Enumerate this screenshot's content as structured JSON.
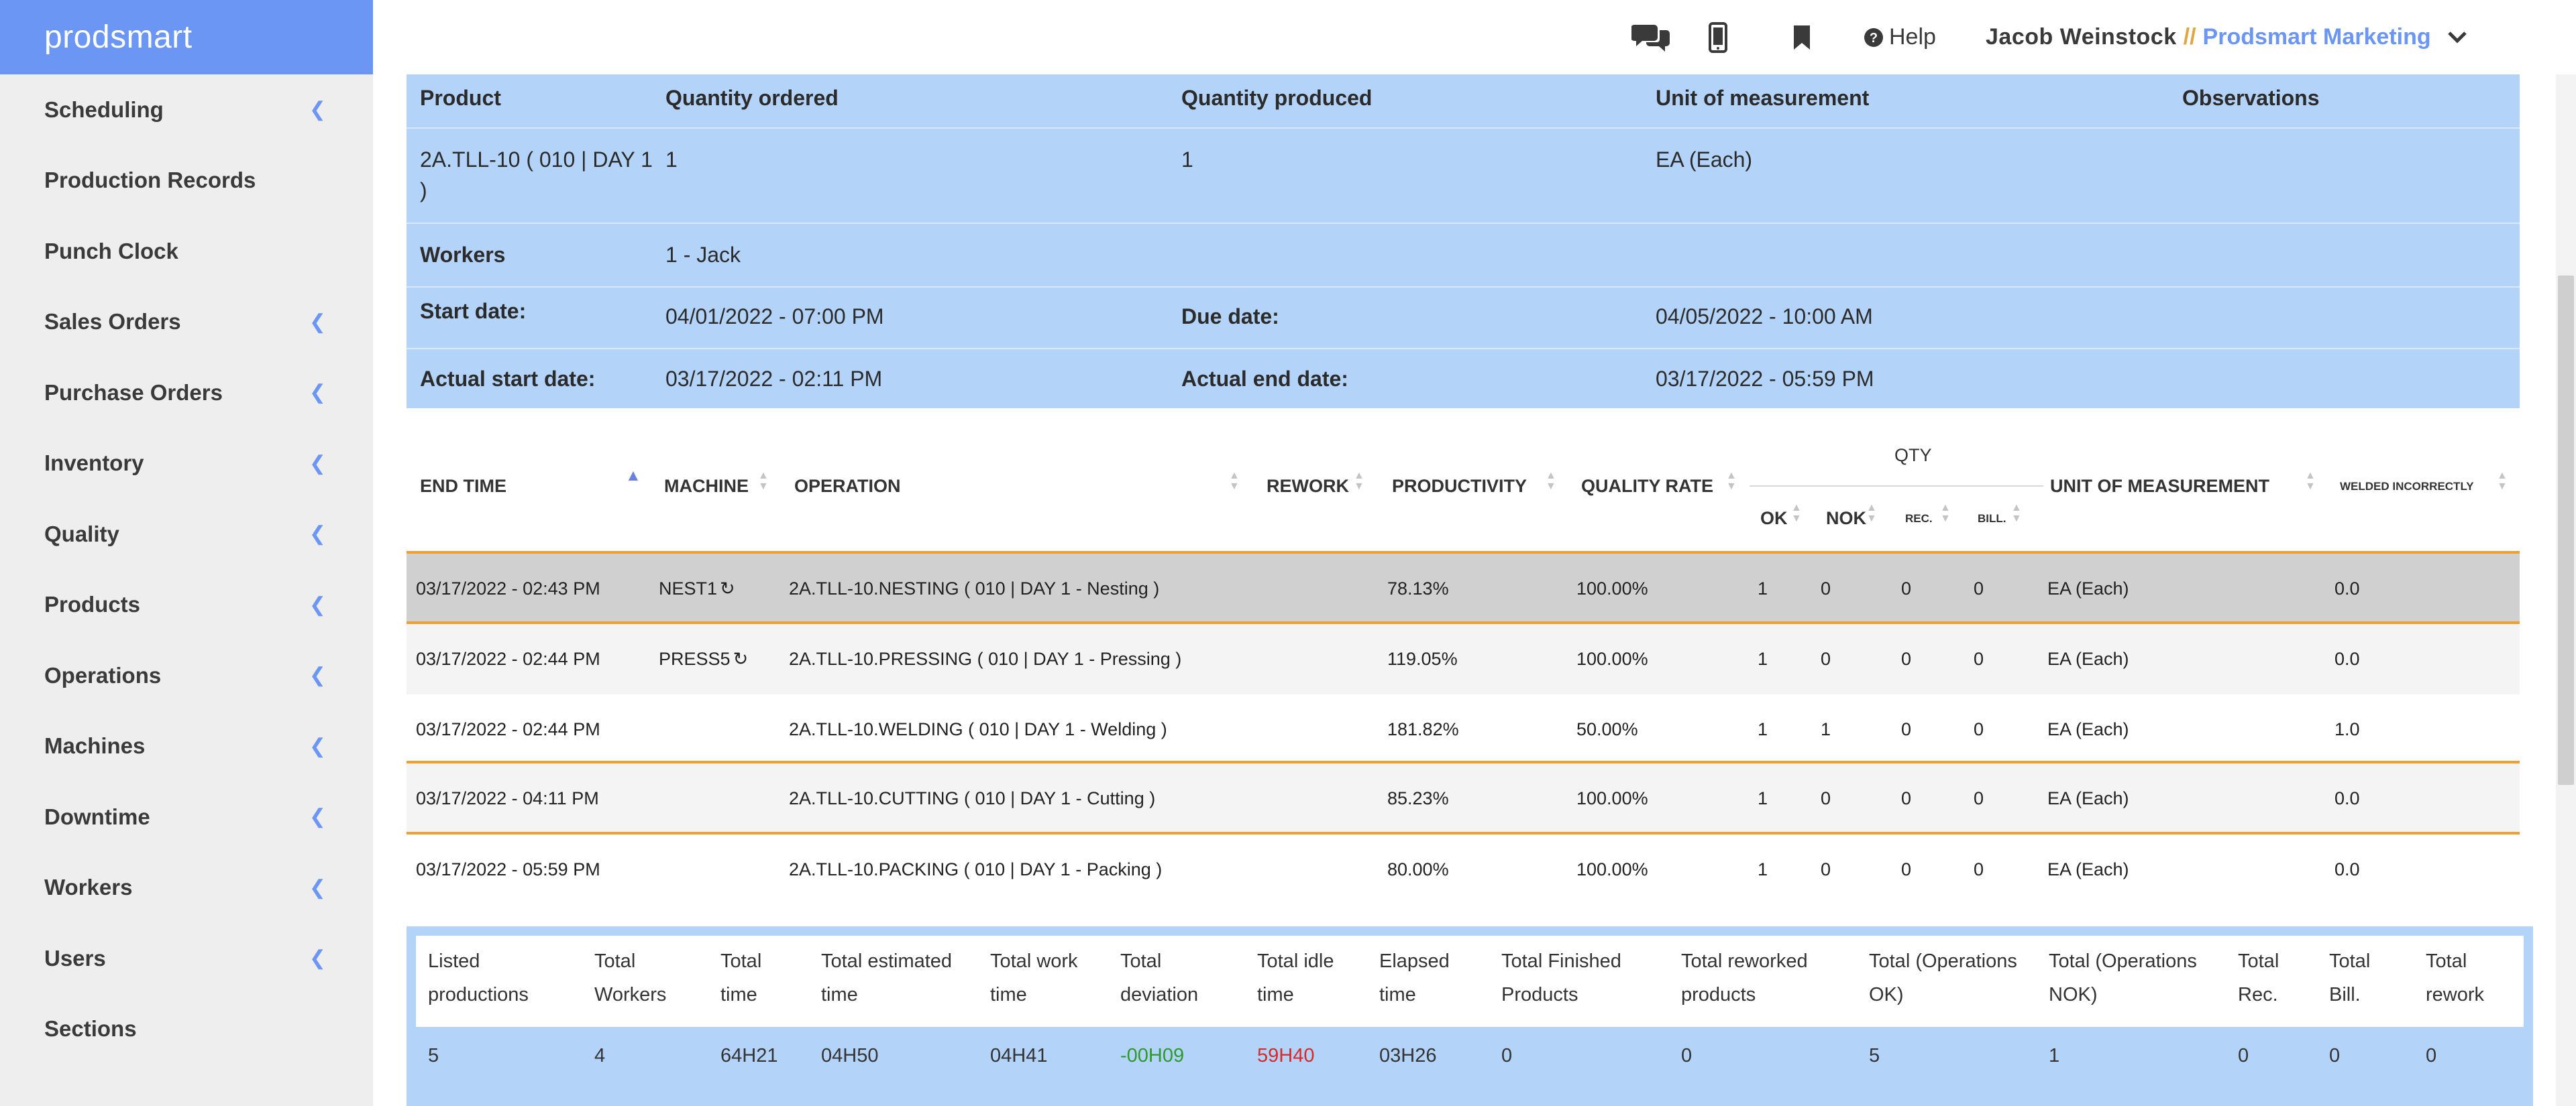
{
  "sidebar": {
    "brand": "prodsmart",
    "items": [
      {
        "label": "Scheduling",
        "chevron": true
      },
      {
        "label": "Production Records",
        "chevron": false
      },
      {
        "label": "Punch Clock",
        "chevron": false
      },
      {
        "label": "Sales Orders",
        "chevron": true
      },
      {
        "label": "Purchase Orders",
        "chevron": true
      },
      {
        "label": "Inventory",
        "chevron": true
      },
      {
        "label": "Quality",
        "chevron": true
      },
      {
        "label": "Products",
        "chevron": true
      },
      {
        "label": "Operations",
        "chevron": true
      },
      {
        "label": "Machines",
        "chevron": true
      },
      {
        "label": "Downtime",
        "chevron": true
      },
      {
        "label": "Workers",
        "chevron": true
      },
      {
        "label": "Users",
        "chevron": true
      },
      {
        "label": "Sections",
        "chevron": false
      }
    ]
  },
  "topbar": {
    "help": "Help",
    "user_name": "Jacob Weinstock",
    "separator": "//",
    "company": "Prodsmart Marketing",
    "icons": [
      "chat-icon",
      "mobile-icon",
      "bookmark-icon",
      "question-circle-icon",
      "chevron-down-icon"
    ]
  },
  "info": {
    "headers": {
      "product": "Product",
      "qty_ordered": "Quantity ordered",
      "qty_produced": "Quantity produced",
      "unit": "Unit of measurement",
      "observations": "Observations"
    },
    "product_line1": "2A.TLL-10 ( 010 | DAY 1",
    "product_line2": ")",
    "qty_ordered": "1",
    "qty_produced": "1",
    "unit": "EA (Each)",
    "workers_label": "Workers",
    "workers": "1 - Jack",
    "start_label": "Start date:",
    "start": "04/01/2022 - 07:00 PM",
    "due_label": "Due date:",
    "due": "04/05/2022 - 10:00 AM",
    "actual_start_label": "Actual start date:",
    "actual_start": "03/17/2022 - 02:11 PM",
    "actual_end_label": "Actual end date:",
    "actual_end": "03/17/2022 - 05:59 PM"
  },
  "ops": {
    "headers": {
      "end_time": "END TIME",
      "machine": "MACHINE",
      "operation": "OPERATION",
      "rework": "REWORK",
      "productivity": "PRODUCTIVITY",
      "quality_rate": "QUALITY RATE",
      "qty": "QTY",
      "ok": "OK",
      "nok": "NOK",
      "rec": "REC.",
      "bill": "BILL.",
      "unit": "UNIT OF MEASUREMENT",
      "welded": "WELDED INCORRECTLY"
    },
    "rows": [
      {
        "end": "03/17/2022 - 02:43 PM",
        "machine": "NEST1",
        "operation": "2A.TLL-10.NESTING ( 010 | DAY 1 - Nesting )",
        "productivity": "78.13%",
        "quality": "100.00%",
        "ok": "1",
        "nok": "0",
        "rec": "0",
        "bill": "0",
        "unit": "EA (Each)",
        "welded": "0.0"
      },
      {
        "end": "03/17/2022 - 02:44 PM",
        "machine": "PRESS5",
        "operation": "2A.TLL-10.PRESSING ( 010 | DAY 1 - Pressing )",
        "productivity": "119.05%",
        "quality": "100.00%",
        "ok": "1",
        "nok": "0",
        "rec": "0",
        "bill": "0",
        "unit": "EA (Each)",
        "welded": "0.0"
      },
      {
        "end": "03/17/2022 - 02:44 PM",
        "machine": "",
        "operation": "2A.TLL-10.WELDING ( 010 | DAY 1 - Welding )",
        "productivity": "181.82%",
        "quality": "50.00%",
        "ok": "1",
        "nok": "1",
        "rec": "0",
        "bill": "0",
        "unit": "EA (Each)",
        "welded": "1.0"
      },
      {
        "end": "03/17/2022 - 04:11 PM",
        "machine": "",
        "operation": "2A.TLL-10.CUTTING ( 010 | DAY 1 - Cutting )",
        "productivity": "85.23%",
        "quality": "100.00%",
        "ok": "1",
        "nok": "0",
        "rec": "0",
        "bill": "0",
        "unit": "EA (Each)",
        "welded": "0.0"
      },
      {
        "end": "03/17/2022 - 05:59 PM",
        "machine": "",
        "operation": "2A.TLL-10.PACKING ( 010 | DAY 1 - Packing )",
        "productivity": "80.00%",
        "quality": "100.00%",
        "ok": "1",
        "nok": "0",
        "rec": "0",
        "bill": "0",
        "unit": "EA (Each)",
        "welded": "0.0"
      }
    ]
  },
  "totals": {
    "headers": [
      [
        "Listed",
        "productions"
      ],
      [
        "Total",
        "Workers"
      ],
      [
        "Total",
        "time"
      ],
      [
        "Total estimated",
        "time"
      ],
      [
        "Total work",
        "time"
      ],
      [
        "Total",
        "deviation"
      ],
      [
        "Total idle",
        "time"
      ],
      [
        "Elapsed",
        "time"
      ],
      [
        "Total Finished",
        "Products"
      ],
      [
        "Total reworked",
        "products"
      ],
      [
        "Total (Operations",
        "OK)"
      ],
      [
        "Total (Operations",
        "NOK)"
      ],
      [
        "Total",
        "Rec."
      ],
      [
        "Total",
        "Bill."
      ],
      [
        "Total",
        "rework"
      ]
    ],
    "values": [
      "5",
      "4",
      "64H21",
      "04H50",
      "04H41",
      "-00H09",
      "59H40",
      "03H26",
      "0",
      "0",
      "5",
      "1",
      "0",
      "0",
      "0"
    ],
    "colors": {
      "deviation": "#2e9a2e",
      "idle": "#d42a2a"
    }
  },
  "colors": {
    "brand": "#6b96f3",
    "info_bg": "#b3d3f9",
    "row_separator": "#f0a030",
    "selected_row": "#d0d0d0"
  }
}
